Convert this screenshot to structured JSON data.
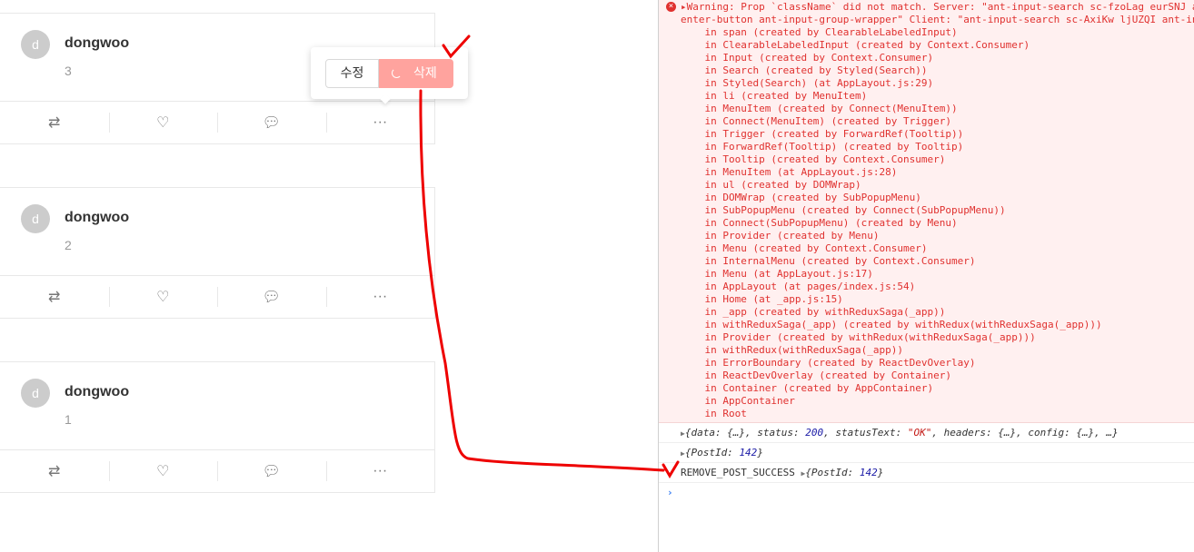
{
  "posts": [
    {
      "avatar": "d",
      "user": "dongwoo",
      "content": "3"
    },
    {
      "avatar": "d",
      "user": "dongwoo",
      "content": "2"
    },
    {
      "avatar": "d",
      "user": "dongwoo",
      "content": "1"
    }
  ],
  "popover": {
    "edit_label": "수정",
    "delete_label": "삭제"
  },
  "console": {
    "error_lines": [
      "▸Warning: Prop `className` did not match. Server: \"ant-input-search sc-fzoLag eurSNJ ant-input-search-",
      "enter-button ant-input-group-wrapper\" Client: \"ant-input-search sc-AxiKw ljUZQI ant-input-search-",
      "    in span (created by ClearableLabeledInput)",
      "    in ClearableLabeledInput (created by Context.Consumer)",
      "    in Input (created by Context.Consumer)",
      "    in Search (created by Styled(Search))",
      "    in Styled(Search) (at AppLayout.js:29)",
      "    in li (created by MenuItem)",
      "    in MenuItem (created by Connect(MenuItem))",
      "    in Connect(MenuItem) (created by Trigger)",
      "    in Trigger (created by ForwardRef(Tooltip))",
      "    in ForwardRef(Tooltip) (created by Tooltip)",
      "    in Tooltip (created by Context.Consumer)",
      "    in MenuItem (at AppLayout.js:28)",
      "    in ul (created by DOMWrap)",
      "    in DOMWrap (created by SubPopupMenu)",
      "    in SubPopupMenu (created by Connect(SubPopupMenu))",
      "    in Connect(SubPopupMenu) (created by Menu)",
      "    in Provider (created by Menu)",
      "    in Menu (created by Context.Consumer)",
      "    in InternalMenu (created by Context.Consumer)",
      "    in Menu (at AppLayout.js:17)",
      "    in AppLayout (at pages/index.js:54)",
      "    in Home (at _app.js:15)",
      "    in _app (created by withReduxSaga(_app))",
      "    in withReduxSaga(_app) (created by withRedux(withReduxSaga(_app)))",
      "    in Provider (created by withRedux(withReduxSaga(_app)))",
      "    in withRedux(withReduxSaga(_app))",
      "    in ErrorBoundary (created by ReactDevOverlay)",
      "    in ReactDevOverlay (created by Container)",
      "    in Container (created by AppContainer)",
      "    in AppContainer",
      "    in Root"
    ],
    "response": {
      "a": "{data: {…}, status: ",
      "status": "200",
      "b": ", statusText: ",
      "statusText": "\"OK\"",
      "c": ", headers: {…}, config: {…}, …}"
    },
    "postid": {
      "a": "{PostId: ",
      "id": "142",
      "b": "}"
    },
    "action": {
      "type": "REMOVE_POST_SUCCESS",
      "a": "{PostId: ",
      "id": "142",
      "b": "}"
    },
    "prompt": "›"
  }
}
